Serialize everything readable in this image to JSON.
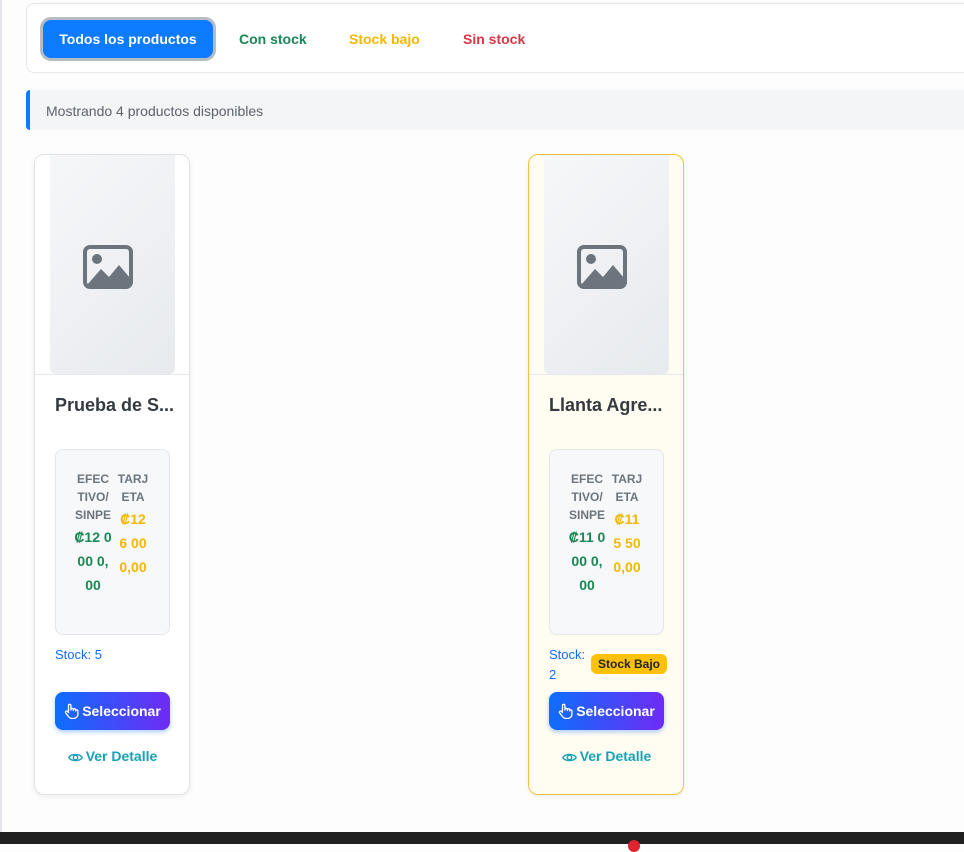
{
  "filters": {
    "all": "Todos los productos",
    "in_stock": "Con stock",
    "low_stock": "Stock bajo",
    "no_stock": "Sin stock"
  },
  "info": {
    "message": "Mostrando 4 productos disponibles"
  },
  "products": [
    {
      "title": "Prueba de S...",
      "cash_label": "EFECTIVO/SINPE",
      "cash_price": "₡12 0 00 0,00",
      "card_label": "TARJETA",
      "card_price": "₡12 6 00 0,00",
      "stock": "Stock: 5",
      "select_label": "Seleccionar",
      "detail_label": "Ver Detalle"
    },
    {
      "title": "Llanta Agre...",
      "cash_label": "EFECTIVO/SINPE",
      "cash_price": "₡11 0 00 0,00",
      "card_label": "TARJETA",
      "card_price": "₡11 5 50 0,00",
      "stock": "Stock: 2",
      "badge": "Stock Bajo",
      "select_label": "Seleccionar",
      "detail_label": "Ver Detalle"
    }
  ],
  "colors": {
    "primary": "#0d7bff",
    "success": "#198754",
    "warning": "#f5b700",
    "danger": "#dc3545",
    "info": "#17a2b8"
  },
  "icons": [
    "image-icon",
    "hand-pointer-icon",
    "eye-icon"
  ]
}
